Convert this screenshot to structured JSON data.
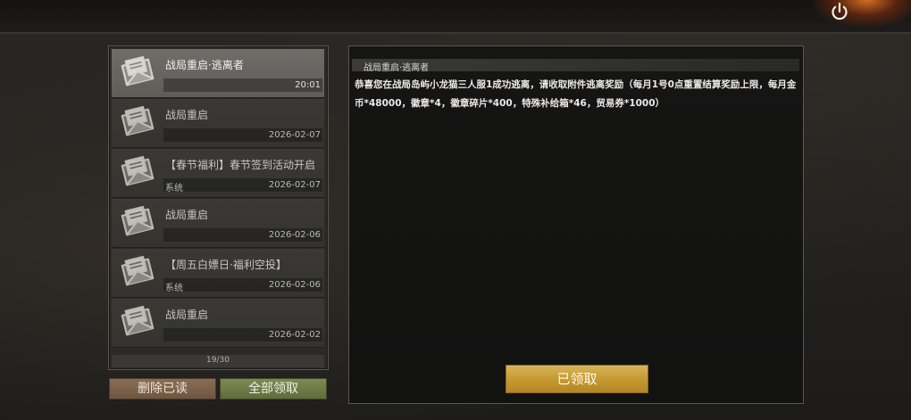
{
  "mail_list": {
    "items": [
      {
        "title": "战局重启·逃离者",
        "sender": "",
        "date": "20:01"
      },
      {
        "title": "战局重启",
        "sender": "",
        "date": "2026-02-07"
      },
      {
        "title": "【春节福利】春节签到活动开启",
        "sender": "系统",
        "date": "2026-02-07"
      },
      {
        "title": "战局重启",
        "sender": "",
        "date": "2026-02-06"
      },
      {
        "title": "【周五白嫖日·福利空投】",
        "sender": "系统",
        "date": "2026-02-06"
      },
      {
        "title": "战局重启",
        "sender": "",
        "date": "2026-02-02"
      }
    ],
    "page_count": "19/30"
  },
  "actions": {
    "delete_read_label": "删除已读",
    "claim_all_label": "全部领取"
  },
  "detail": {
    "title": "战局重启·逃离者",
    "body": "恭喜您在战局岛屿小龙猫三人服1成功逃离，请收取附件逃离奖励（每月1号0点重置结算奖励上限，每月金币*48000，徽章*4，徽章碎片*400，特殊补给箱*46，贸易券*1000）",
    "claimed_label": "已领取"
  },
  "icons": {
    "mail": "envelope-letter-icon",
    "power": "power-icon"
  },
  "colors": {
    "claimed_button": "#c9a040",
    "claim_all_button": "#6f7c46",
    "delete_button": "#7d624c",
    "power_glow": "#e07828"
  }
}
